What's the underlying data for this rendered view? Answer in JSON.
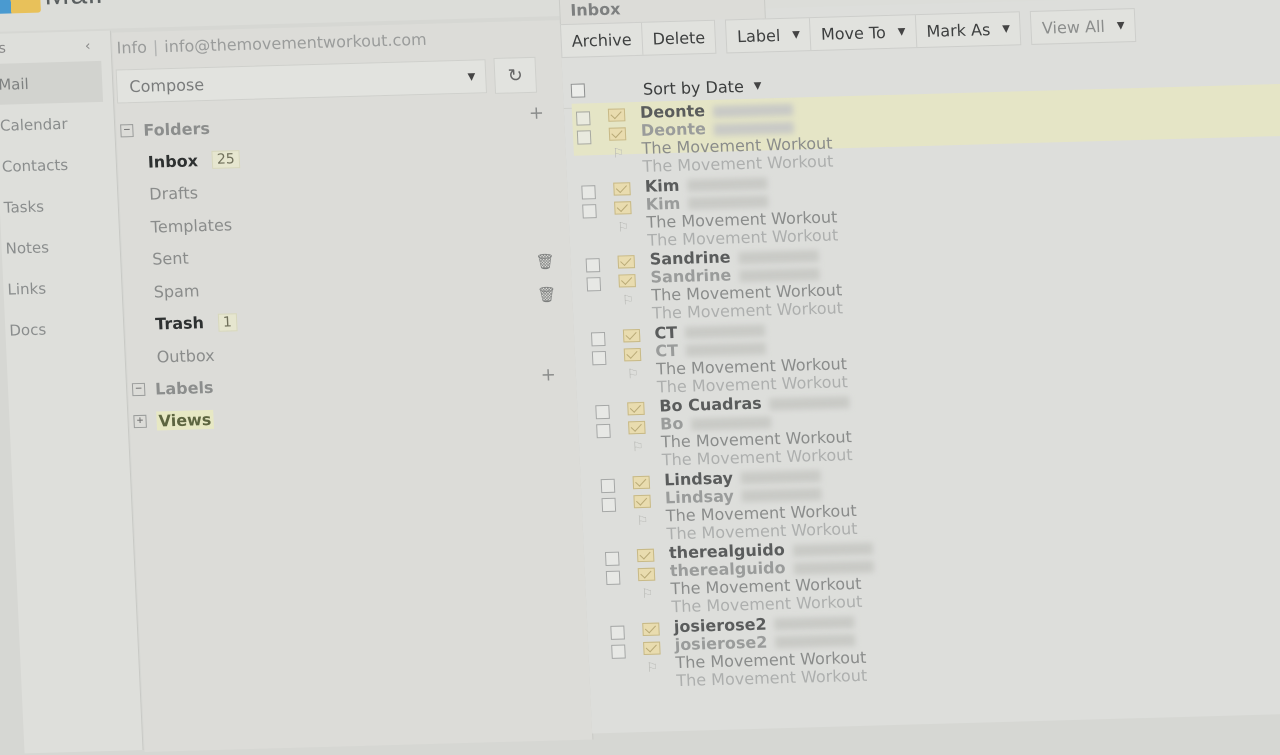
{
  "app": {
    "name": "Mail"
  },
  "left_nav": {
    "collapse_icon": "chevron-left-icon",
    "items": [
      {
        "label": "Mail",
        "active": true
      },
      {
        "label": "Calendar"
      },
      {
        "label": "Contacts"
      },
      {
        "label": "Tasks"
      },
      {
        "label": "Notes"
      },
      {
        "label": "Links"
      },
      {
        "label": "Docs"
      }
    ]
  },
  "account": {
    "name": "Info",
    "separator": "|",
    "email": "info@themovementworkout.com"
  },
  "compose": {
    "label": "Compose",
    "refresh_icon": "refresh-icon"
  },
  "folders": {
    "heading": "Folders",
    "items": [
      {
        "label": "Inbox",
        "count": "25",
        "bold": true
      },
      {
        "label": "Drafts"
      },
      {
        "label": "Templates"
      },
      {
        "label": "Sent"
      },
      {
        "label": "Spam"
      },
      {
        "label": "Trash",
        "count": "1",
        "bold": true
      },
      {
        "label": "Outbox"
      }
    ]
  },
  "labels": {
    "heading": "Labels"
  },
  "views": {
    "heading": "Views"
  },
  "main": {
    "tab": "Inbox",
    "toolbar": {
      "archive": "Archive",
      "delete": "Delete",
      "label": "Label",
      "move_to": "Move To",
      "mark_as": "Mark As",
      "view_all": "View All"
    },
    "sort": "Sort by Date",
    "messages": [
      {
        "sender": "Deonte",
        "subject": "The Movement Workout"
      },
      {
        "sender": "Kim",
        "subject": "The Movement Workout"
      },
      {
        "sender": "Sandrine",
        "subject": "The Movement Workout"
      },
      {
        "sender": "CT",
        "subject": "The Movement Workout"
      },
      {
        "sender": "Bo Cuadras",
        "sender_ghost": "Bo",
        "subject": "The Movement Workout"
      },
      {
        "sender": "Lindsay",
        "subject": "The Movement Workout"
      },
      {
        "sender": "therealguido",
        "subject": "The Movement Workout"
      },
      {
        "sender": "josierose2",
        "subject": "The Movement Workout"
      }
    ]
  }
}
